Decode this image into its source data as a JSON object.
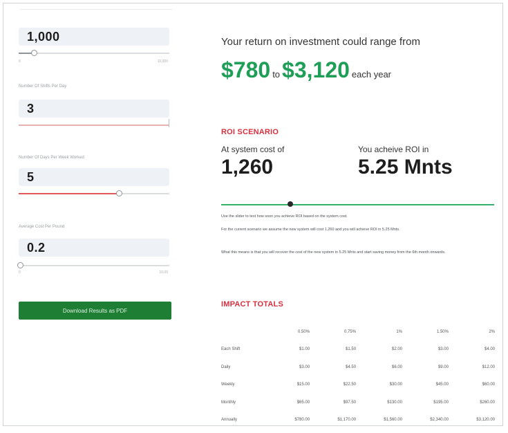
{
  "inputs": [
    {
      "label": "",
      "value": "1,000",
      "min_label": "0",
      "max_label": "10,000",
      "fraction": 0.1
    },
    {
      "label": "Number Of Shifts Per Day",
      "value": "3",
      "min_label": "",
      "max_label": "",
      "fraction": 1.0
    },
    {
      "label": "Number Of Days Per Week Worked",
      "value": "5",
      "min_label": "",
      "max_label": "",
      "fraction": 0.67
    },
    {
      "label": "Average Cost Per Pound",
      "value": "0.2",
      "min_label": "0",
      "max_label": "10.00",
      "fraction": 0.0
    }
  ],
  "download_button_label": "Download Results as PDF",
  "roi": {
    "lead": "Your return on investment could range from",
    "low": "$780",
    "to_word": "to",
    "high": "$3,120",
    "suffix": "each year"
  },
  "scenario": {
    "title": "ROI SCENARIO",
    "cost_label": "At system cost of",
    "cost_value": "1,260",
    "roi_label": "You acheive ROI in",
    "roi_value": "5.25 Mnts",
    "slider_fraction": 0.25,
    "notes": [
      "Use the slider to test how soon you achieve ROI based on the system cost.",
      "For the current scenario we assume the new system will cost 1,260 and you will achieve ROI in 5.25 Mnts.",
      "What this means is that you will recover the cost of the new system in 5.25 Mnts and start saving money from the 6th month onwards."
    ]
  },
  "impact": {
    "title": "IMPACT TOTALS",
    "columns": [
      "0.50%",
      "0.75%",
      "1%",
      "1.50%",
      "2%"
    ],
    "rows": [
      {
        "label": "Each Shift",
        "values": [
          "$1.00",
          "$1.50",
          "$2.00",
          "$3.00",
          "$4.00"
        ]
      },
      {
        "label": "Daily",
        "values": [
          "$3.00",
          "$4.50",
          "$6.00",
          "$9.00",
          "$12.00"
        ]
      },
      {
        "label": "Weekly",
        "values": [
          "$15.00",
          "$22.50",
          "$30.00",
          "$45.00",
          "$60.00"
        ]
      },
      {
        "label": "Monthly",
        "values": [
          "$65.00",
          "$97.50",
          "$130.00",
          "$195.00",
          "$260.00"
        ]
      },
      {
        "label": "Annually",
        "values": [
          "$780.00",
          "$1,170.00",
          "$1,560.00",
          "$2,340.00",
          "$3,120.00"
        ]
      }
    ]
  },
  "colors": {
    "accent_green": "#1e9e57",
    "button_green": "#1e7e34",
    "section_red": "#d62f3e",
    "slider_red": "#e05a5a"
  }
}
